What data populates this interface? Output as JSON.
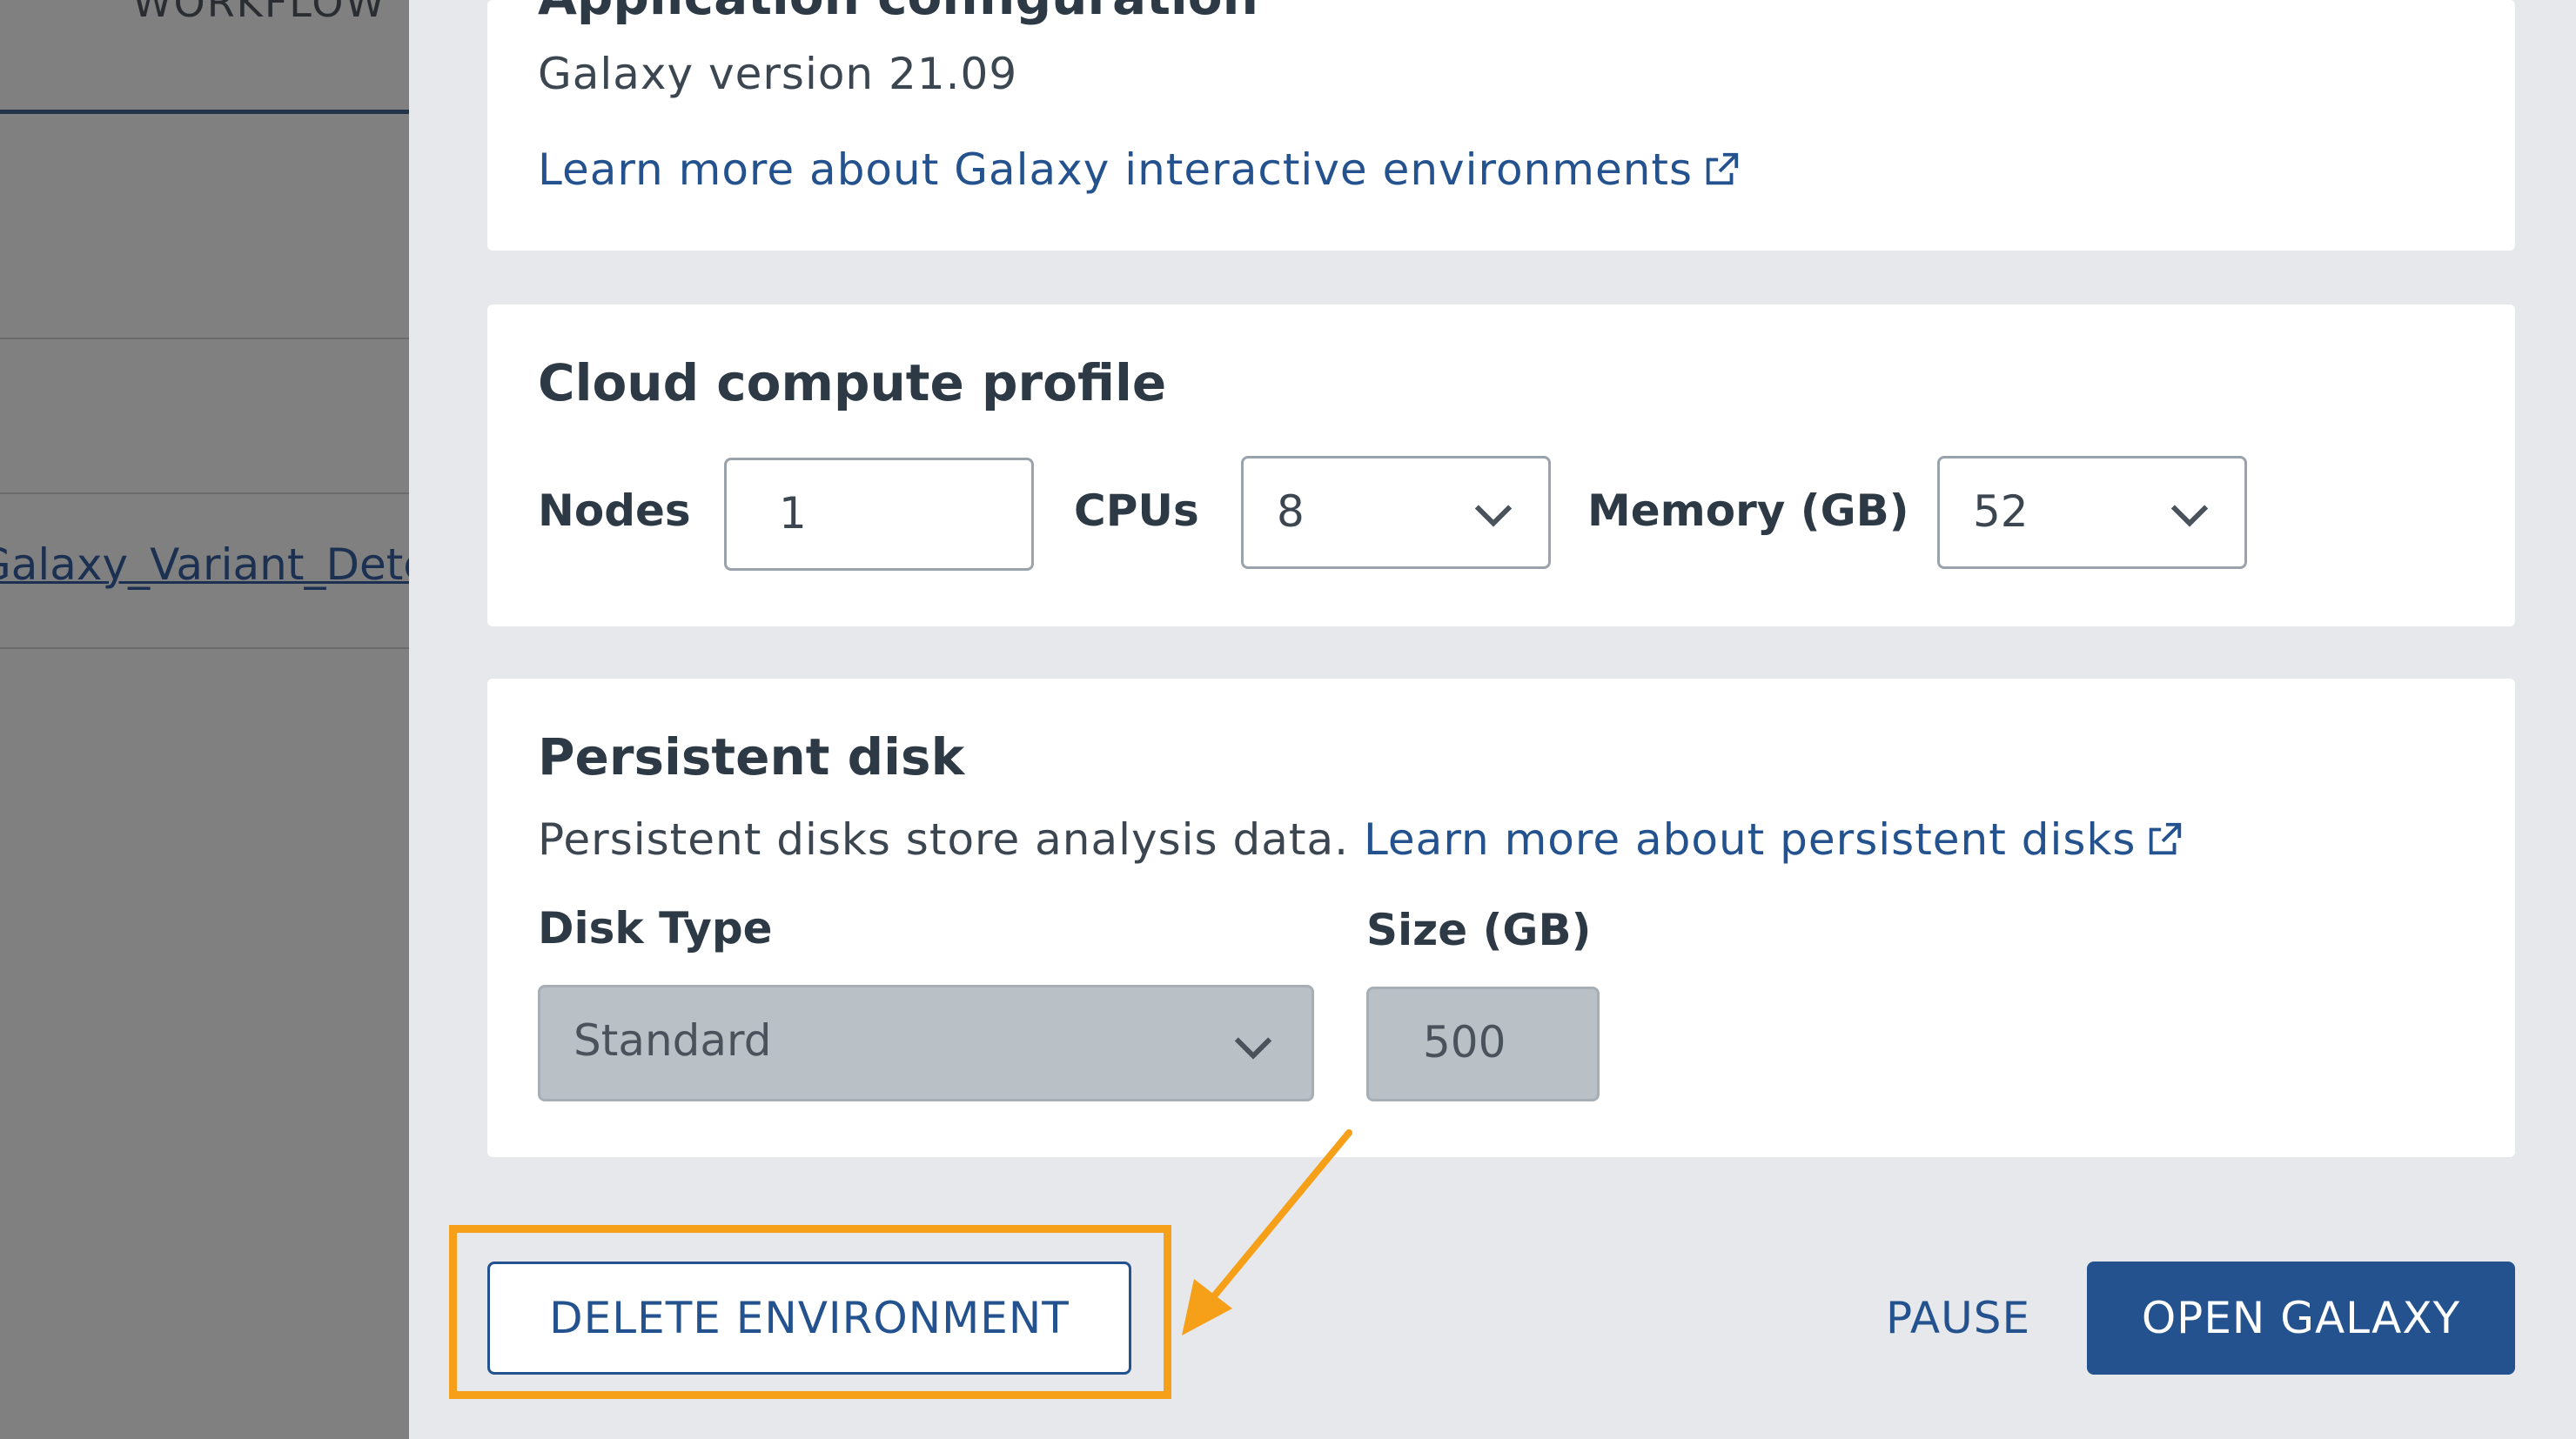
{
  "background": {
    "workflows_header": "WORKFLOW",
    "workflow_link": "Galaxy_Variant_Detection"
  },
  "app_config": {
    "title": "Application configuration",
    "version_text": "Galaxy version 21.09",
    "learn_more_link": "Learn more about Galaxy interactive environments"
  },
  "cloud_compute": {
    "title": "Cloud compute profile",
    "nodes_label": "Nodes",
    "nodes_value": "1",
    "cpus_label": "CPUs",
    "cpus_value": "8",
    "memory_label": "Memory (GB)",
    "memory_value": "52"
  },
  "persistent_disk": {
    "title": "Persistent disk",
    "description": "Persistent disks store analysis data.",
    "learn_more_link": "Learn more about persistent disks",
    "disk_type_label": "Disk Type",
    "disk_type_value": "Standard",
    "size_label": "Size (GB)",
    "size_value": "500"
  },
  "actions": {
    "delete": "DELETE ENVIRONMENT",
    "pause": "PAUSE",
    "open": "OPEN GALAXY"
  },
  "colors": {
    "primary": "#23528e",
    "highlight": "#f6a01a",
    "panel_bg": "#e6e8eb"
  }
}
